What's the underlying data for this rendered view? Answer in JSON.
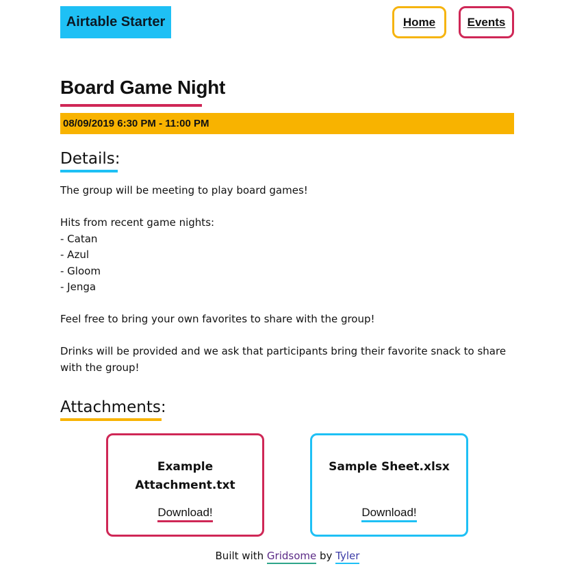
{
  "header": {
    "brand": "Airtable Starter",
    "nav": {
      "home": "Home",
      "events": "Events"
    }
  },
  "event": {
    "title": "Board Game Night",
    "datetime": "08/09/2019 6:30 PM - 11:00 PM"
  },
  "details": {
    "heading": "Details:",
    "paragraphs": [
      "The group will be meeting to play board games!",
      "Hits from recent game nights:\n- Catan\n- Azul\n- Gloom\n- Jenga",
      "Feel free to bring your own favorites to share with the group!",
      "Drinks will be provided and we ask that participants bring their favorite snack to share with the group!"
    ]
  },
  "attachments": {
    "heading": "Attachments:",
    "items": [
      {
        "name": "Example Attachment.txt",
        "download": "Download!"
      },
      {
        "name": "Sample Sheet.xlsx",
        "download": "Download!"
      }
    ]
  },
  "footer": {
    "prefix": "Built with",
    "framework": "Gridsome",
    "by": "by",
    "author": "Tyler"
  },
  "colors": {
    "brand_blue": "#1ec0f5",
    "accent_yellow": "#f8b300",
    "accent_red": "#cf2756",
    "footer_green": "#2ea58a"
  }
}
